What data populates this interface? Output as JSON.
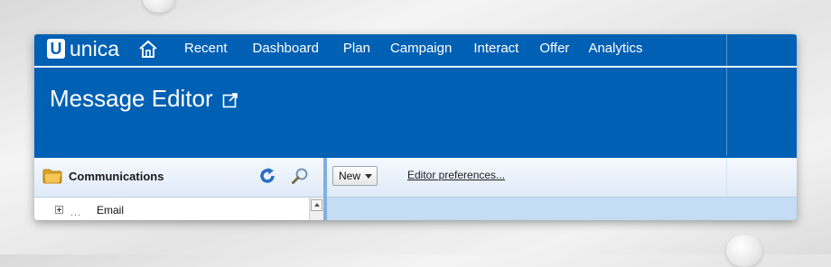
{
  "brand": {
    "initial": "U",
    "name": "unica"
  },
  "nav": {
    "items": [
      "Recent",
      "Dashboard",
      "Plan",
      "Campaign",
      "Interact",
      "Offer",
      "Analytics"
    ]
  },
  "page": {
    "title": "Message Editor"
  },
  "left_panel": {
    "title": "Communications",
    "tree": [
      {
        "dots": "...",
        "label": "Email"
      }
    ]
  },
  "toolbar": {
    "new_label": "New",
    "editor_prefs_label": "Editor preferences..."
  },
  "colors": {
    "header_blue": "#0060b4",
    "panel_header": "#dfeaf7",
    "content_area": "#c4dcf4"
  },
  "icons": [
    "home-icon",
    "popout-icon",
    "folder-icon",
    "refresh-icon",
    "search-icon",
    "expand-icon",
    "dropdown-arrow-icon",
    "scroll-up-icon"
  ]
}
